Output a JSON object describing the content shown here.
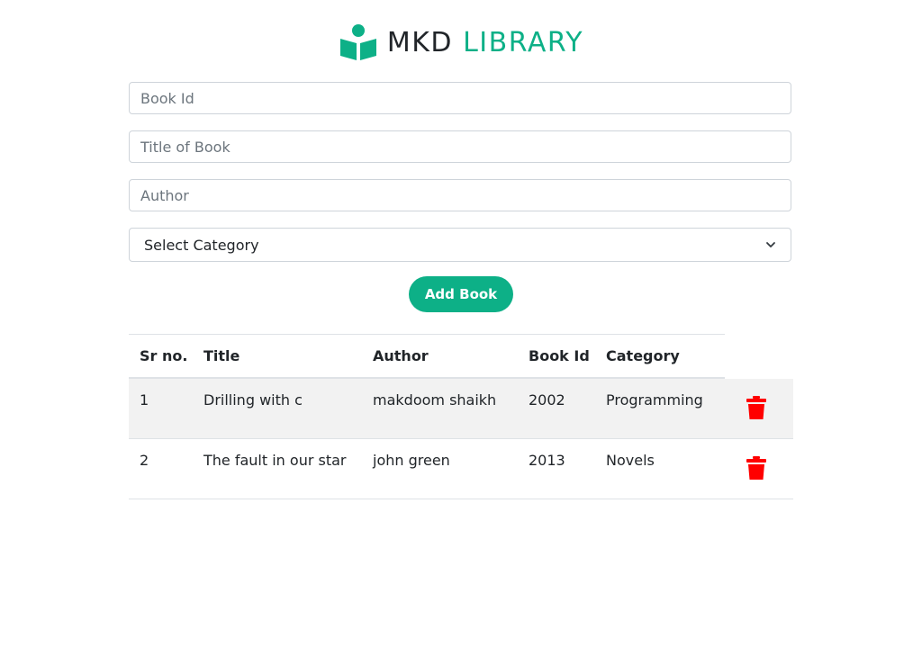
{
  "header": {
    "brand_part1": "MKD",
    "brand_part2": "LIBRARY",
    "logo_icon": "reading-person-icon",
    "accent_color": "#0db087"
  },
  "form": {
    "book_id_placeholder": "Book Id",
    "title_placeholder": "Title of Book",
    "author_placeholder": "Author",
    "category_selected": "Select Category",
    "add_button_label": "Add Book"
  },
  "table": {
    "headers": [
      "Sr no.",
      "Title",
      "Author",
      "Book Id",
      "Category"
    ],
    "rows": [
      {
        "sr": "1",
        "title": "Drilling with c",
        "author": "makdoom shaikh",
        "book_id": "2002",
        "category": "Programming"
      },
      {
        "sr": "2",
        "title": "The fault in our star",
        "author": "john green",
        "book_id": "2013",
        "category": "Novels"
      }
    ],
    "delete_icon": "trash-icon",
    "delete_color": "#ff0000"
  }
}
